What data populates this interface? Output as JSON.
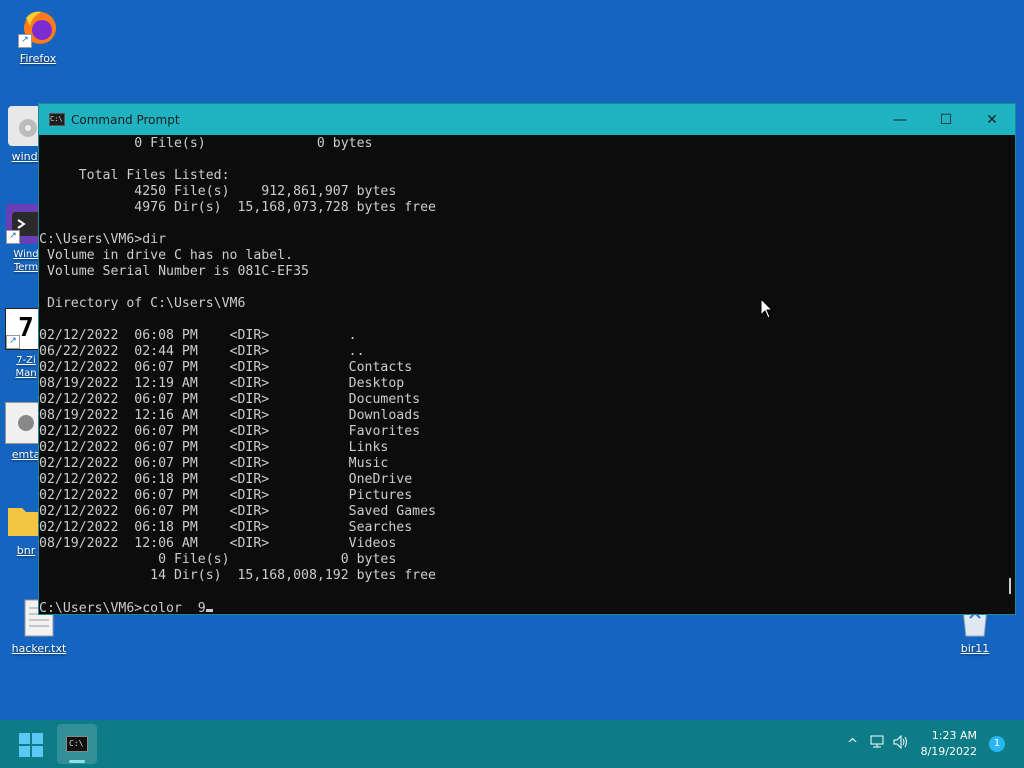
{
  "desktop": {
    "icons": [
      {
        "label": "Firefox"
      },
      {
        "label": "windo"
      },
      {
        "label": "Wind\nTerm"
      },
      {
        "label": "7-Zi\nMan"
      },
      {
        "label": "emta"
      },
      {
        "label": "bnr"
      },
      {
        "label": "hacker.txt"
      },
      {
        "label": "bir11"
      }
    ]
  },
  "window": {
    "title": "Command Prompt",
    "app_icon_text": "C:\\",
    "minimize": "—",
    "maximize": "☐",
    "close": "✕",
    "console_lines": [
      "            0 File(s)              0 bytes",
      "",
      "     Total Files Listed:",
      "            4250 File(s)    912,861,907 bytes",
      "            4976 Dir(s)  15,168,073,728 bytes free",
      "",
      "C:\\Users\\VM6>dir",
      " Volume in drive C has no label.",
      " Volume Serial Number is 081C-EF35",
      "",
      " Directory of C:\\Users\\VM6",
      "",
      "02/12/2022  06:08 PM    <DIR>          .",
      "06/22/2022  02:44 PM    <DIR>          ..",
      "02/12/2022  06:07 PM    <DIR>          Contacts",
      "08/19/2022  12:19 AM    <DIR>          Desktop",
      "02/12/2022  06:07 PM    <DIR>          Documents",
      "08/19/2022  12:16 AM    <DIR>          Downloads",
      "02/12/2022  06:07 PM    <DIR>          Favorites",
      "02/12/2022  06:07 PM    <DIR>          Links",
      "02/12/2022  06:07 PM    <DIR>          Music",
      "02/12/2022  06:18 PM    <DIR>          OneDrive",
      "02/12/2022  06:07 PM    <DIR>          Pictures",
      "02/12/2022  06:07 PM    <DIR>          Saved Games",
      "02/12/2022  06:18 PM    <DIR>          Searches",
      "08/19/2022  12:06 AM    <DIR>          Videos",
      "               0 File(s)              0 bytes",
      "              14 Dir(s)  15,168,008,192 bytes free",
      ""
    ],
    "prompt_line": "C:\\Users\\VM6>color  9"
  },
  "taskbar": {
    "task_icon_text": "C:\\",
    "tray_chevron": "^",
    "clock_time": "1:23 AM",
    "clock_date": "8/19/2022",
    "notification_count": "1"
  },
  "colors": {
    "desktop": "#1565c0",
    "titlebar": "#1fb3c2",
    "taskbar": "#0e7c86",
    "console_bg": "#0c0c0c",
    "console_text": "#cccccc"
  }
}
